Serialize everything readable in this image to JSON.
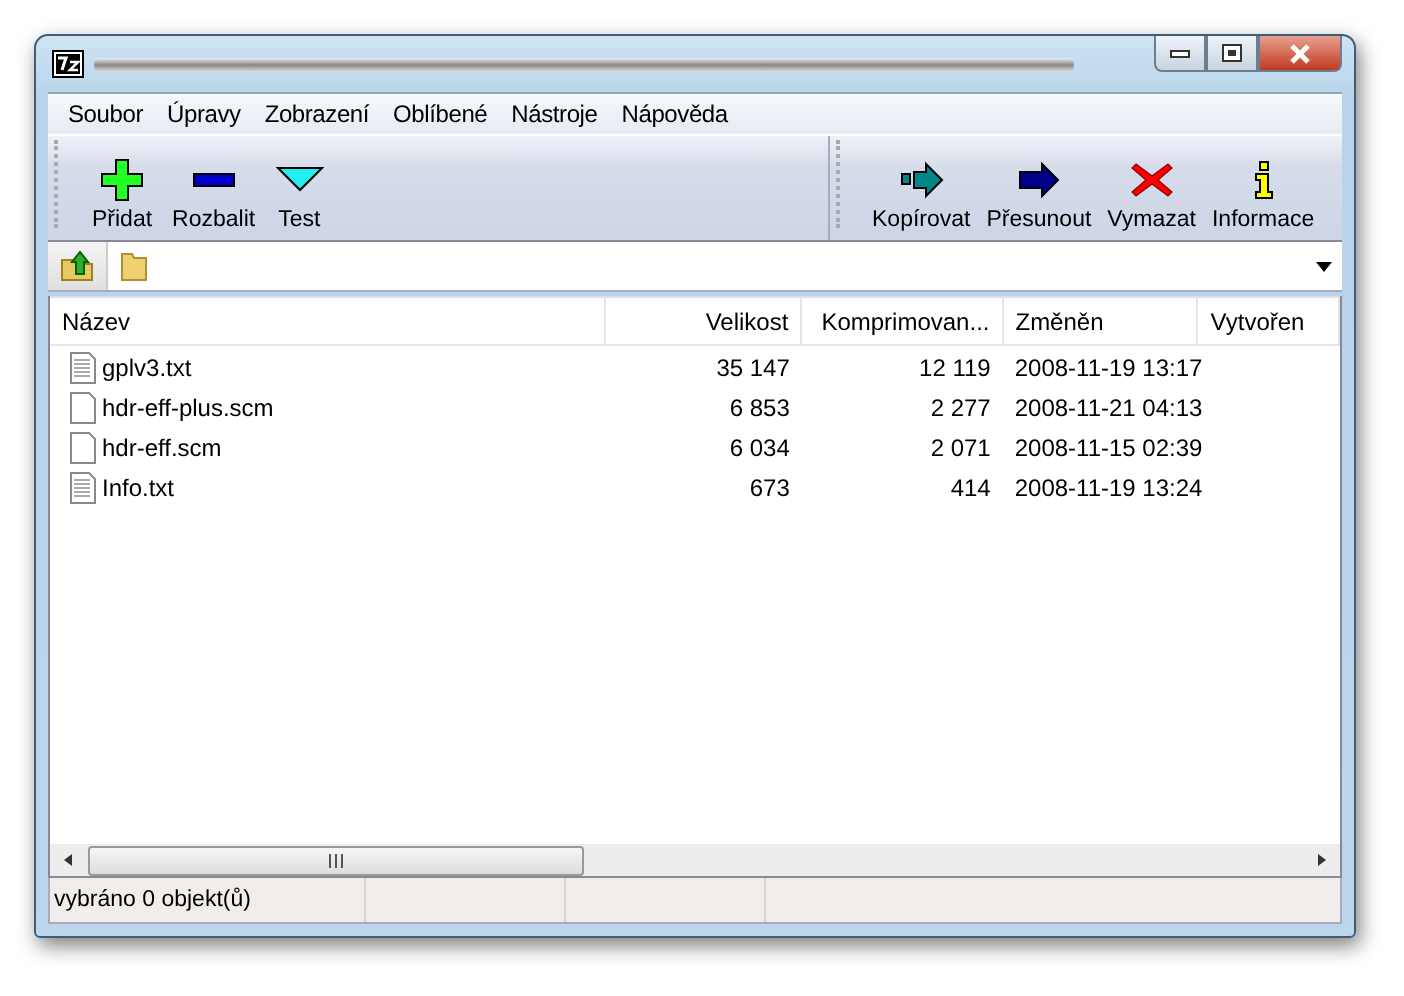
{
  "menu": [
    "Soubor",
    "Úpravy",
    "Zobrazení",
    "Oblíbené",
    "Nástroje",
    "Nápověda"
  ],
  "toolbar_left": [
    {
      "label": "Přidat",
      "kind": "add"
    },
    {
      "label": "Rozbalit",
      "kind": "extract"
    },
    {
      "label": "Test",
      "kind": "test"
    }
  ],
  "toolbar_right": [
    {
      "label": "Kopírovat",
      "kind": "copy"
    },
    {
      "label": "Přesunout",
      "kind": "move"
    },
    {
      "label": "Vymazat",
      "kind": "delete"
    },
    {
      "label": "Informace",
      "kind": "info"
    }
  ],
  "table": {
    "columns": [
      "Název",
      "Velikost",
      "Komprimovan...",
      "Změněn",
      "Vytvořen"
    ],
    "rows": [
      {
        "name": "gplv3.txt",
        "kind": "text",
        "size": "35 147",
        "packed": "12 119",
        "modified": "2008-11-19 13:17"
      },
      {
        "name": "hdr-eff-plus.scm",
        "kind": "file",
        "size": "6 853",
        "packed": "2 277",
        "modified": "2008-11-21 04:13"
      },
      {
        "name": "hdr-eff.scm",
        "kind": "file",
        "size": "6 034",
        "packed": "2 071",
        "modified": "2008-11-15 02:39"
      },
      {
        "name": "Info.txt",
        "kind": "text",
        "size": "673",
        "packed": "414",
        "modified": "2008-11-19 13:24"
      }
    ]
  },
  "status_bar": [
    "vybráno 0 objekt(ů)"
  ]
}
